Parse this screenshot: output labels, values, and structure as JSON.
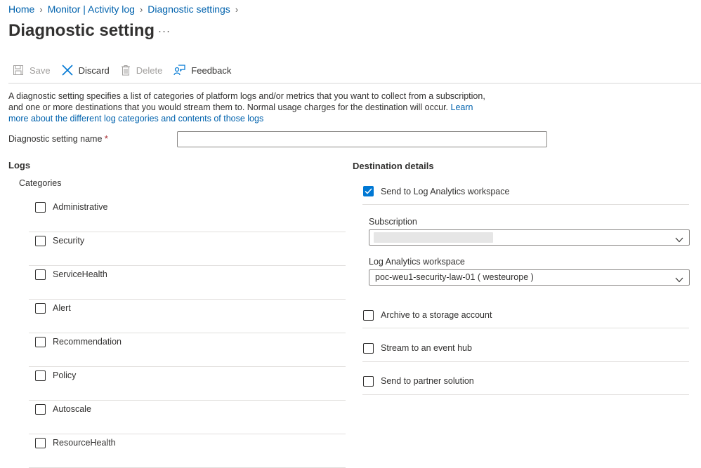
{
  "breadcrumb": [
    {
      "label": "Home"
    },
    {
      "label": "Monitor | Activity log"
    },
    {
      "label": "Diagnostic settings"
    }
  ],
  "page": {
    "title": "Diagnostic setting",
    "more": "···"
  },
  "toolbar": {
    "save": "Save",
    "discard": "Discard",
    "delete": "Delete",
    "feedback": "Feedback"
  },
  "description": {
    "text": "A diagnostic setting specifies a list of categories of platform logs and/or metrics that you want to collect from a subscription, and one or more destinations that you would stream them to. Normal usage charges for the destination will occur.",
    "link": "Learn more about the different log categories and contents of those logs"
  },
  "name_field": {
    "label": "Diagnostic setting name",
    "required_mark": "*",
    "value": ""
  },
  "logs": {
    "heading": "Logs",
    "categories_label": "Categories",
    "categories": [
      {
        "label": "Administrative",
        "checked": false
      },
      {
        "label": "Security",
        "checked": false
      },
      {
        "label": "ServiceHealth",
        "checked": false
      },
      {
        "label": "Alert",
        "checked": false
      },
      {
        "label": "Recommendation",
        "checked": false
      },
      {
        "label": "Policy",
        "checked": false
      },
      {
        "label": "Autoscale",
        "checked": false
      },
      {
        "label": "ResourceHealth",
        "checked": false
      }
    ]
  },
  "destination": {
    "heading": "Destination details",
    "log_analytics": {
      "label": "Send to Log Analytics workspace",
      "checked": true
    },
    "subscription": {
      "label": "Subscription",
      "value": ""
    },
    "workspace": {
      "label": "Log Analytics workspace",
      "value": "poc-weu1-security-law-01 ( westeurope )"
    },
    "archive": {
      "label": "Archive to a storage account",
      "checked": false
    },
    "event_hub": {
      "label": "Stream to an event hub",
      "checked": false
    },
    "partner": {
      "label": "Send to partner solution",
      "checked": false
    }
  },
  "colors": {
    "link": "#0062ad",
    "accent": "#0078d4",
    "text": "#323130",
    "required": "#a4262c"
  }
}
